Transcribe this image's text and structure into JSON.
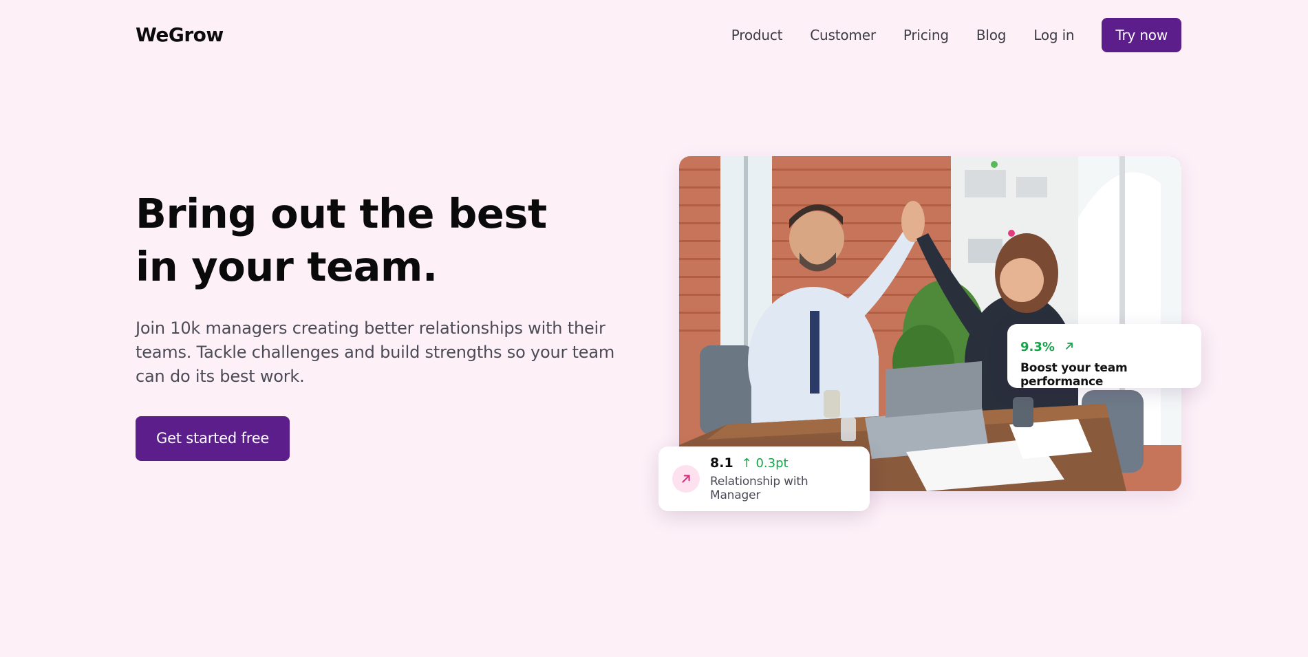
{
  "header": {
    "logo": "WeGrow",
    "nav": {
      "product": "Product",
      "customer": "Customer",
      "pricing": "Pricing",
      "blog": "Blog",
      "login": "Log in",
      "cta": "Try now"
    }
  },
  "hero": {
    "title": "Bring out the best in your team.",
    "subtitle": "Join 10k managers creating better relationships with their teams. Tackle challenges and build strengths so your team can do its best work.",
    "cta": "Get started free"
  },
  "cards": {
    "boost": {
      "value": "9.3%",
      "label": "Boost your team performance"
    },
    "relationship": {
      "score": "8.1",
      "delta": "↑ 0.3pt",
      "label": "Relationship with Manager"
    }
  },
  "colors": {
    "background": "#fdf0f7",
    "brand": "#5b1e8a",
    "positive": "#16a34a",
    "icon_bg": "#fde1ef",
    "icon_fg": "#db2777"
  },
  "icons": {
    "boost_arrow": "arrow-up-right-icon",
    "relationship_icon": "arrow-up-right-icon"
  }
}
